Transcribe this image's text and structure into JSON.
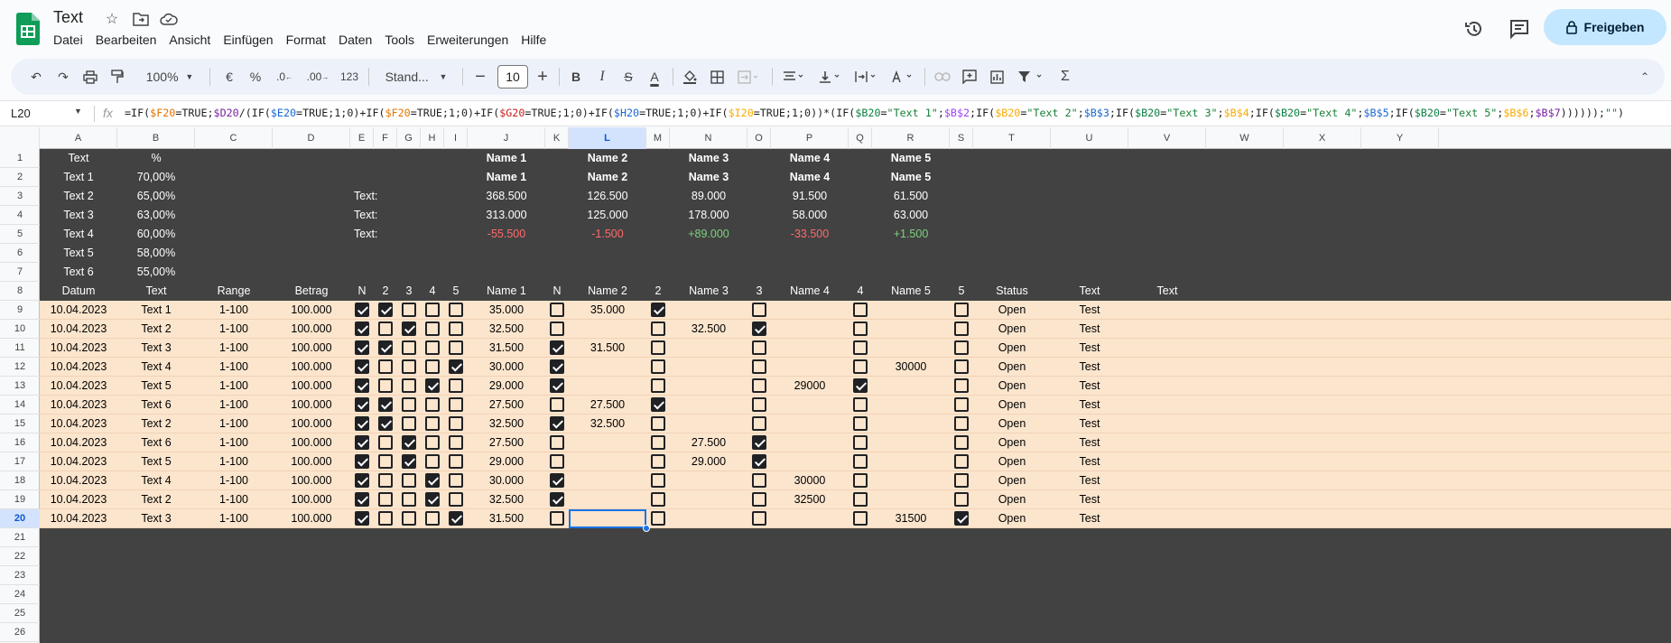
{
  "app": {
    "doc_title": "Text",
    "menu": [
      "Datei",
      "Bearbeiten",
      "Ansicht",
      "Einfügen",
      "Format",
      "Daten",
      "Tools",
      "Erweiterungen",
      "Hilfe"
    ],
    "share_label": "Freigeben"
  },
  "toolbar": {
    "zoom": "100%",
    "currency": "€",
    "percent": "%",
    "dec_less": ".0",
    "dec_more": ".00",
    "format_123": "123",
    "font": "Stand...",
    "font_size": "10",
    "bold": "B",
    "italic": "I",
    "underline_color_letter": "A"
  },
  "formula_bar": {
    "name_box": "L20",
    "fx": "fx",
    "formula_parts": [
      [
        "=IF(",
        ""
      ],
      [
        "$F20",
        "fr"
      ],
      [
        "=TRUE;",
        ""
      ],
      [
        "$D20",
        "fv"
      ],
      [
        "/(IF(",
        ""
      ],
      [
        "$E20",
        "fb"
      ],
      [
        "=TRUE;1;0)+IF(",
        ""
      ],
      [
        "$F20",
        "fr"
      ],
      [
        "=TRUE;1;0)+IF(",
        ""
      ],
      [
        "$G20",
        "fo"
      ],
      [
        "=TRUE;1;0)+IF(",
        ""
      ],
      [
        "$H20",
        "fb"
      ],
      [
        "=TRUE;1;0)+IF(",
        ""
      ],
      [
        "$I20",
        "fy"
      ],
      [
        "=TRUE;1;0))*(IF(",
        ""
      ],
      [
        "$B20",
        "fc"
      ],
      [
        "=",
        ""
      ],
      [
        "\"Text 1\"",
        "fg"
      ],
      [
        ";",
        ""
      ],
      [
        "$B$2",
        "fk"
      ],
      [
        ";IF(",
        ""
      ],
      [
        "$B20",
        "fy"
      ],
      [
        "=",
        ""
      ],
      [
        "\"Text 2\"",
        "fg"
      ],
      [
        ";",
        ""
      ],
      [
        "$B$3",
        "fb"
      ],
      [
        ";IF(",
        ""
      ],
      [
        "$B20",
        "fc"
      ],
      [
        "=",
        ""
      ],
      [
        "\"Text 3\"",
        "fg"
      ],
      [
        ";",
        ""
      ],
      [
        "$B$4",
        "fy"
      ],
      [
        ";IF(",
        ""
      ],
      [
        "$B20",
        "fc"
      ],
      [
        "=",
        ""
      ],
      [
        "\"Text 4\"",
        "fg"
      ],
      [
        ";",
        ""
      ],
      [
        "$B$5",
        "fb"
      ],
      [
        ";IF(",
        ""
      ],
      [
        "$B20",
        "fc"
      ],
      [
        "=",
        ""
      ],
      [
        "\"Text 5\"",
        "fg"
      ],
      [
        ";",
        ""
      ],
      [
        "$B$6",
        "fy"
      ],
      [
        ";",
        ""
      ],
      [
        "$B$7",
        "fv"
      ],
      [
        "))))));",
        ""
      ],
      [
        "\"\"",
        "fg"
      ],
      [
        ")",
        ""
      ]
    ]
  },
  "selected_cell": {
    "col": "L",
    "row": "20"
  },
  "columns": [
    "A",
    "B",
    "C",
    "D",
    "E",
    "F",
    "G",
    "H",
    "I",
    "J",
    "K",
    "L",
    "M",
    "N",
    "O",
    "P",
    "Q",
    "R",
    "S",
    "T",
    "U",
    "V",
    "W",
    "X",
    "Y"
  ],
  "rows": [
    "1",
    "2",
    "3",
    "4",
    "5",
    "6",
    "7",
    "8",
    "9",
    "10",
    "11",
    "12",
    "13",
    "14",
    "15",
    "16",
    "17",
    "18",
    "19",
    "20",
    "21",
    "22",
    "23",
    "24",
    "25",
    "26"
  ],
  "sheet": {
    "top_block": {
      "A1": "Text",
      "B1": "%",
      "J1": "Name 1",
      "L1": "Name 2",
      "N1": "Name 3",
      "P1": "Name 4",
      "R1": "Name 5",
      "J2": "Name 1",
      "L2": "Name 2",
      "N2": "Name 3",
      "P2": "Name 4",
      "R2": "Name 5",
      "A2": "Text 1",
      "B2": "70,00%",
      "A3": "Text 2",
      "B3": "65,00%",
      "E3": "Text:",
      "J3": "368.500",
      "L3": "126.500",
      "N3": "89.000",
      "P3": "91.500",
      "R3": "61.500",
      "A4": "Text 3",
      "B4": "63,00%",
      "E4": "Text:",
      "J4": "313.000",
      "L4": "125.000",
      "N4": "178.000",
      "P4": "58.000",
      "R4": "63.000",
      "A5": "Text 4",
      "B5": "60,00%",
      "E5": "Text:",
      "J5": "-55.500",
      "L5": "-1.500",
      "N5": "+89.000",
      "P5": "-33.500",
      "R5": "+1.500",
      "A6": "Text 5",
      "B6": "58,00%",
      "A7": "Text 6",
      "B7": "55,00%"
    },
    "header_row": {
      "A": "Datum",
      "B": "Text",
      "C": "Range",
      "D": "Betrag",
      "E": "N",
      "F": "2",
      "G": "3",
      "H": "4",
      "I": "5",
      "J": "Name 1",
      "K": "N",
      "L": "Name 2",
      "M": "2",
      "N": "Name 3",
      "O": "3",
      "P": "Name 4",
      "Q": "4",
      "R": "Name 5",
      "S": "5",
      "T": "Status",
      "U": "Text",
      "V": "Text"
    },
    "data_rows": [
      {
        "A": "10.04.2023",
        "B": "Text 1",
        "C": "1-100",
        "D": "100.000",
        "cb": [
          1,
          1,
          0,
          0,
          0
        ],
        "J": "35.000",
        "K": 0,
        "L": "35.000",
        "M": 1,
        "N": "",
        "O": 0,
        "P": "",
        "Q": 0,
        "R": "",
        "S": 0,
        "T": "Open",
        "U": "Test"
      },
      {
        "A": "10.04.2023",
        "B": "Text 2",
        "C": "1-100",
        "D": "100.000",
        "cb": [
          1,
          0,
          1,
          0,
          0
        ],
        "J": "32.500",
        "K": 0,
        "L": "",
        "M": 0,
        "N": "32.500",
        "O": 1,
        "P": "",
        "Q": 0,
        "R": "",
        "S": 0,
        "T": "Open",
        "U": "Test"
      },
      {
        "A": "10.04.2023",
        "B": "Text 3",
        "C": "1-100",
        "D": "100.000",
        "cb": [
          1,
          1,
          0,
          0,
          0
        ],
        "J": "31.500",
        "K": 1,
        "L": "31.500",
        "M": 0,
        "N": "",
        "O": 0,
        "P": "",
        "Q": 0,
        "R": "",
        "S": 0,
        "T": "Open",
        "U": "Test"
      },
      {
        "A": "10.04.2023",
        "B": "Text 4",
        "C": "1-100",
        "D": "100.000",
        "cb": [
          1,
          0,
          0,
          0,
          1
        ],
        "J": "30.000",
        "K": 1,
        "L": "",
        "M": 0,
        "N": "",
        "O": 0,
        "P": "",
        "Q": 0,
        "R": "30000",
        "S": 0,
        "T": "Open",
        "U": "Test"
      },
      {
        "A": "10.04.2023",
        "B": "Text 5",
        "C": "1-100",
        "D": "100.000",
        "cb": [
          1,
          0,
          0,
          1,
          0
        ],
        "J": "29.000",
        "K": 1,
        "L": "",
        "M": 0,
        "N": "",
        "O": 0,
        "P": "29000",
        "Q": 1,
        "R": "",
        "S": 0,
        "T": "Open",
        "U": "Test"
      },
      {
        "A": "10.04.2023",
        "B": "Text 6",
        "C": "1-100",
        "D": "100.000",
        "cb": [
          1,
          1,
          0,
          0,
          0
        ],
        "J": "27.500",
        "K": 0,
        "L": "27.500",
        "M": 1,
        "N": "",
        "O": 0,
        "P": "",
        "Q": 0,
        "R": "",
        "S": 0,
        "T": "Open",
        "U": "Test"
      },
      {
        "A": "10.04.2023",
        "B": "Text 2",
        "C": "1-100",
        "D": "100.000",
        "cb": [
          1,
          1,
          0,
          0,
          0
        ],
        "J": "32.500",
        "K": 1,
        "L": "32.500",
        "M": 0,
        "N": "",
        "O": 0,
        "P": "",
        "Q": 0,
        "R": "",
        "S": 0,
        "T": "Open",
        "U": "Test"
      },
      {
        "A": "10.04.2023",
        "B": "Text 6",
        "C": "1-100",
        "D": "100.000",
        "cb": [
          1,
          0,
          1,
          0,
          0
        ],
        "J": "27.500",
        "K": 0,
        "L": "",
        "M": 0,
        "N": "27.500",
        "O": 1,
        "P": "",
        "Q": 0,
        "R": "",
        "S": 0,
        "T": "Open",
        "U": "Test"
      },
      {
        "A": "10.04.2023",
        "B": "Text 5",
        "C": "1-100",
        "D": "100.000",
        "cb": [
          1,
          0,
          1,
          0,
          0
        ],
        "J": "29.000",
        "K": 0,
        "L": "",
        "M": 0,
        "N": "29.000",
        "O": 1,
        "P": "",
        "Q": 0,
        "R": "",
        "S": 0,
        "T": "Open",
        "U": "Test"
      },
      {
        "A": "10.04.2023",
        "B": "Text 4",
        "C": "1-100",
        "D": "100.000",
        "cb": [
          1,
          0,
          0,
          1,
          0
        ],
        "J": "30.000",
        "K": 1,
        "L": "",
        "M": 0,
        "N": "",
        "O": 0,
        "P": "30000",
        "Q": 0,
        "R": "",
        "S": 0,
        "T": "Open",
        "U": "Test"
      },
      {
        "A": "10.04.2023",
        "B": "Text 2",
        "C": "1-100",
        "D": "100.000",
        "cb": [
          1,
          0,
          0,
          1,
          0
        ],
        "J": "32.500",
        "K": 1,
        "L": "",
        "M": 0,
        "N": "",
        "O": 0,
        "P": "32500",
        "Q": 0,
        "R": "",
        "S": 0,
        "T": "Open",
        "U": "Test"
      },
      {
        "A": "10.04.2023",
        "B": "Text 3",
        "C": "1-100",
        "D": "100.000",
        "cb": [
          1,
          0,
          0,
          0,
          1
        ],
        "J": "31.500",
        "K": 0,
        "L": "",
        "M": 0,
        "N": "",
        "O": 0,
        "P": "",
        "Q": 0,
        "R": "31500",
        "S": 1,
        "T": "Open",
        "U": "Test"
      }
    ]
  },
  "colors": {
    "dark_bg": "#424242",
    "band_bg": "#fce5cd",
    "accent": "#1a73e8",
    "share_bg": "#c2e7ff",
    "negative": "#ff6b6b",
    "positive": "#7ed07e"
  }
}
